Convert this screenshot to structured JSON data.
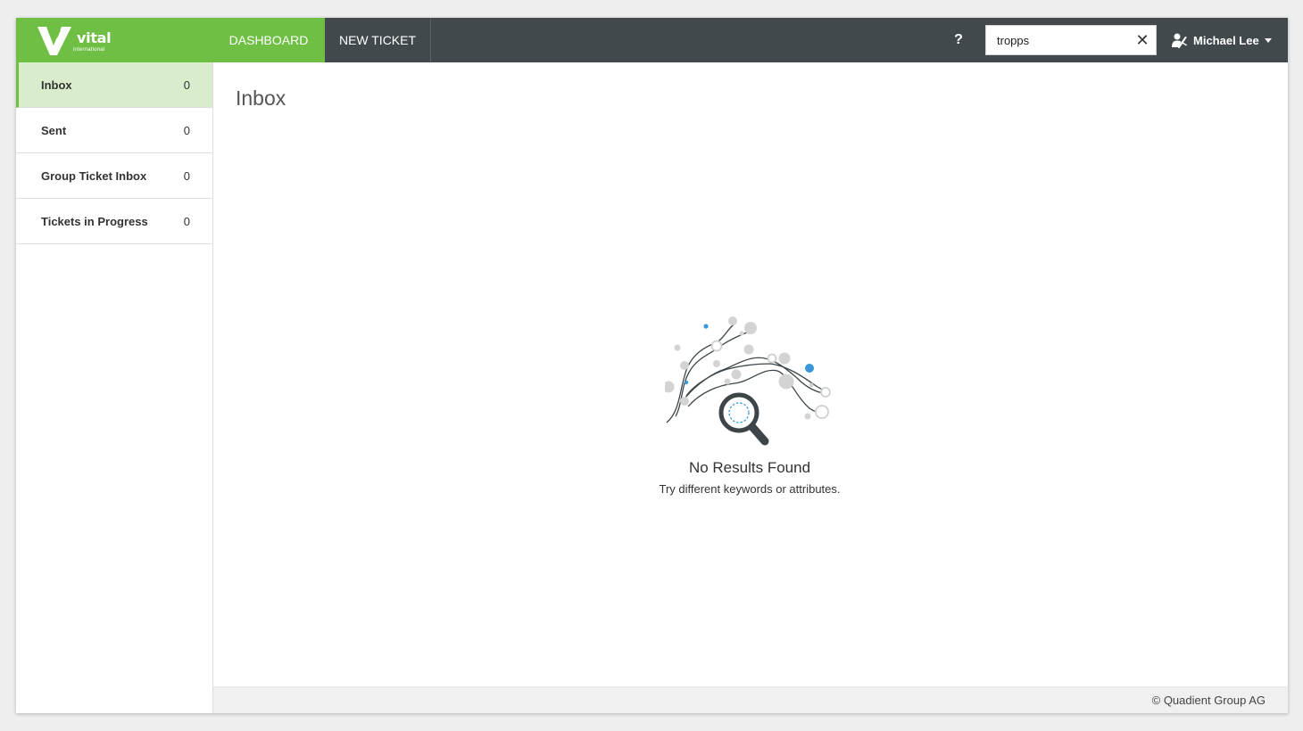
{
  "brand": {
    "name": "vital",
    "tagline": "international",
    "color": "#6fbf44"
  },
  "nav": {
    "tabs": [
      {
        "label": "DASHBOARD",
        "active": true
      },
      {
        "label": "NEW TICKET",
        "active": false
      }
    ],
    "help_label": "?",
    "topbar_color": "#41494d"
  },
  "search": {
    "value": "tropps",
    "clear_icon": "close-icon"
  },
  "user": {
    "name": "Michael Lee",
    "icon": "user-switch-icon"
  },
  "sidebar": {
    "items": [
      {
        "label": "Inbox",
        "count": "0",
        "active": true
      },
      {
        "label": "Sent",
        "count": "0",
        "active": false
      },
      {
        "label": "Group Ticket Inbox",
        "count": "0",
        "active": false
      },
      {
        "label": "Tickets in Progress",
        "count": "0",
        "active": false
      }
    ]
  },
  "main": {
    "title": "Inbox",
    "empty": {
      "title": "No Results Found",
      "subtitle": "Try different keywords or attributes.",
      "icon": "no-results-search-illustration"
    }
  },
  "footer": {
    "copyright": "© Quadient Group AG"
  }
}
